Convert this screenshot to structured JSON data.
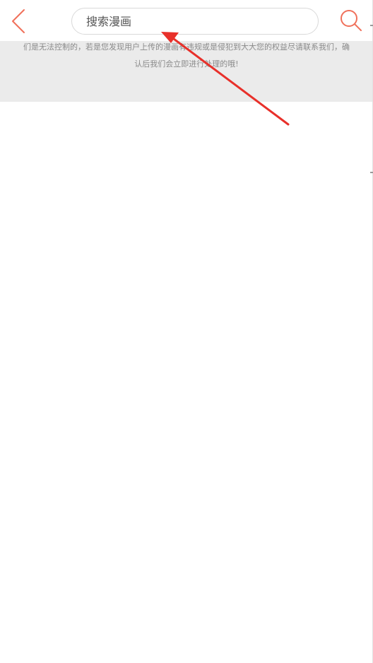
{
  "header": {
    "back_icon": "chevron-left-icon",
    "search_placeholder": "搜索漫画",
    "search_value": "",
    "search_icon": "magnifier-icon",
    "accent_color": "#f0705a"
  },
  "notice": {
    "line1": "们是无法控制的，若是您发现用户上传的漫画有违规或是侵犯到大大您的权益尽请联系我们，确",
    "line2": "认后我们会立即进行处理的哦!",
    "background": "#ebebeb"
  },
  "annotation": {
    "type": "arrow",
    "color": "#e8302a",
    "points_to": "search-input"
  }
}
